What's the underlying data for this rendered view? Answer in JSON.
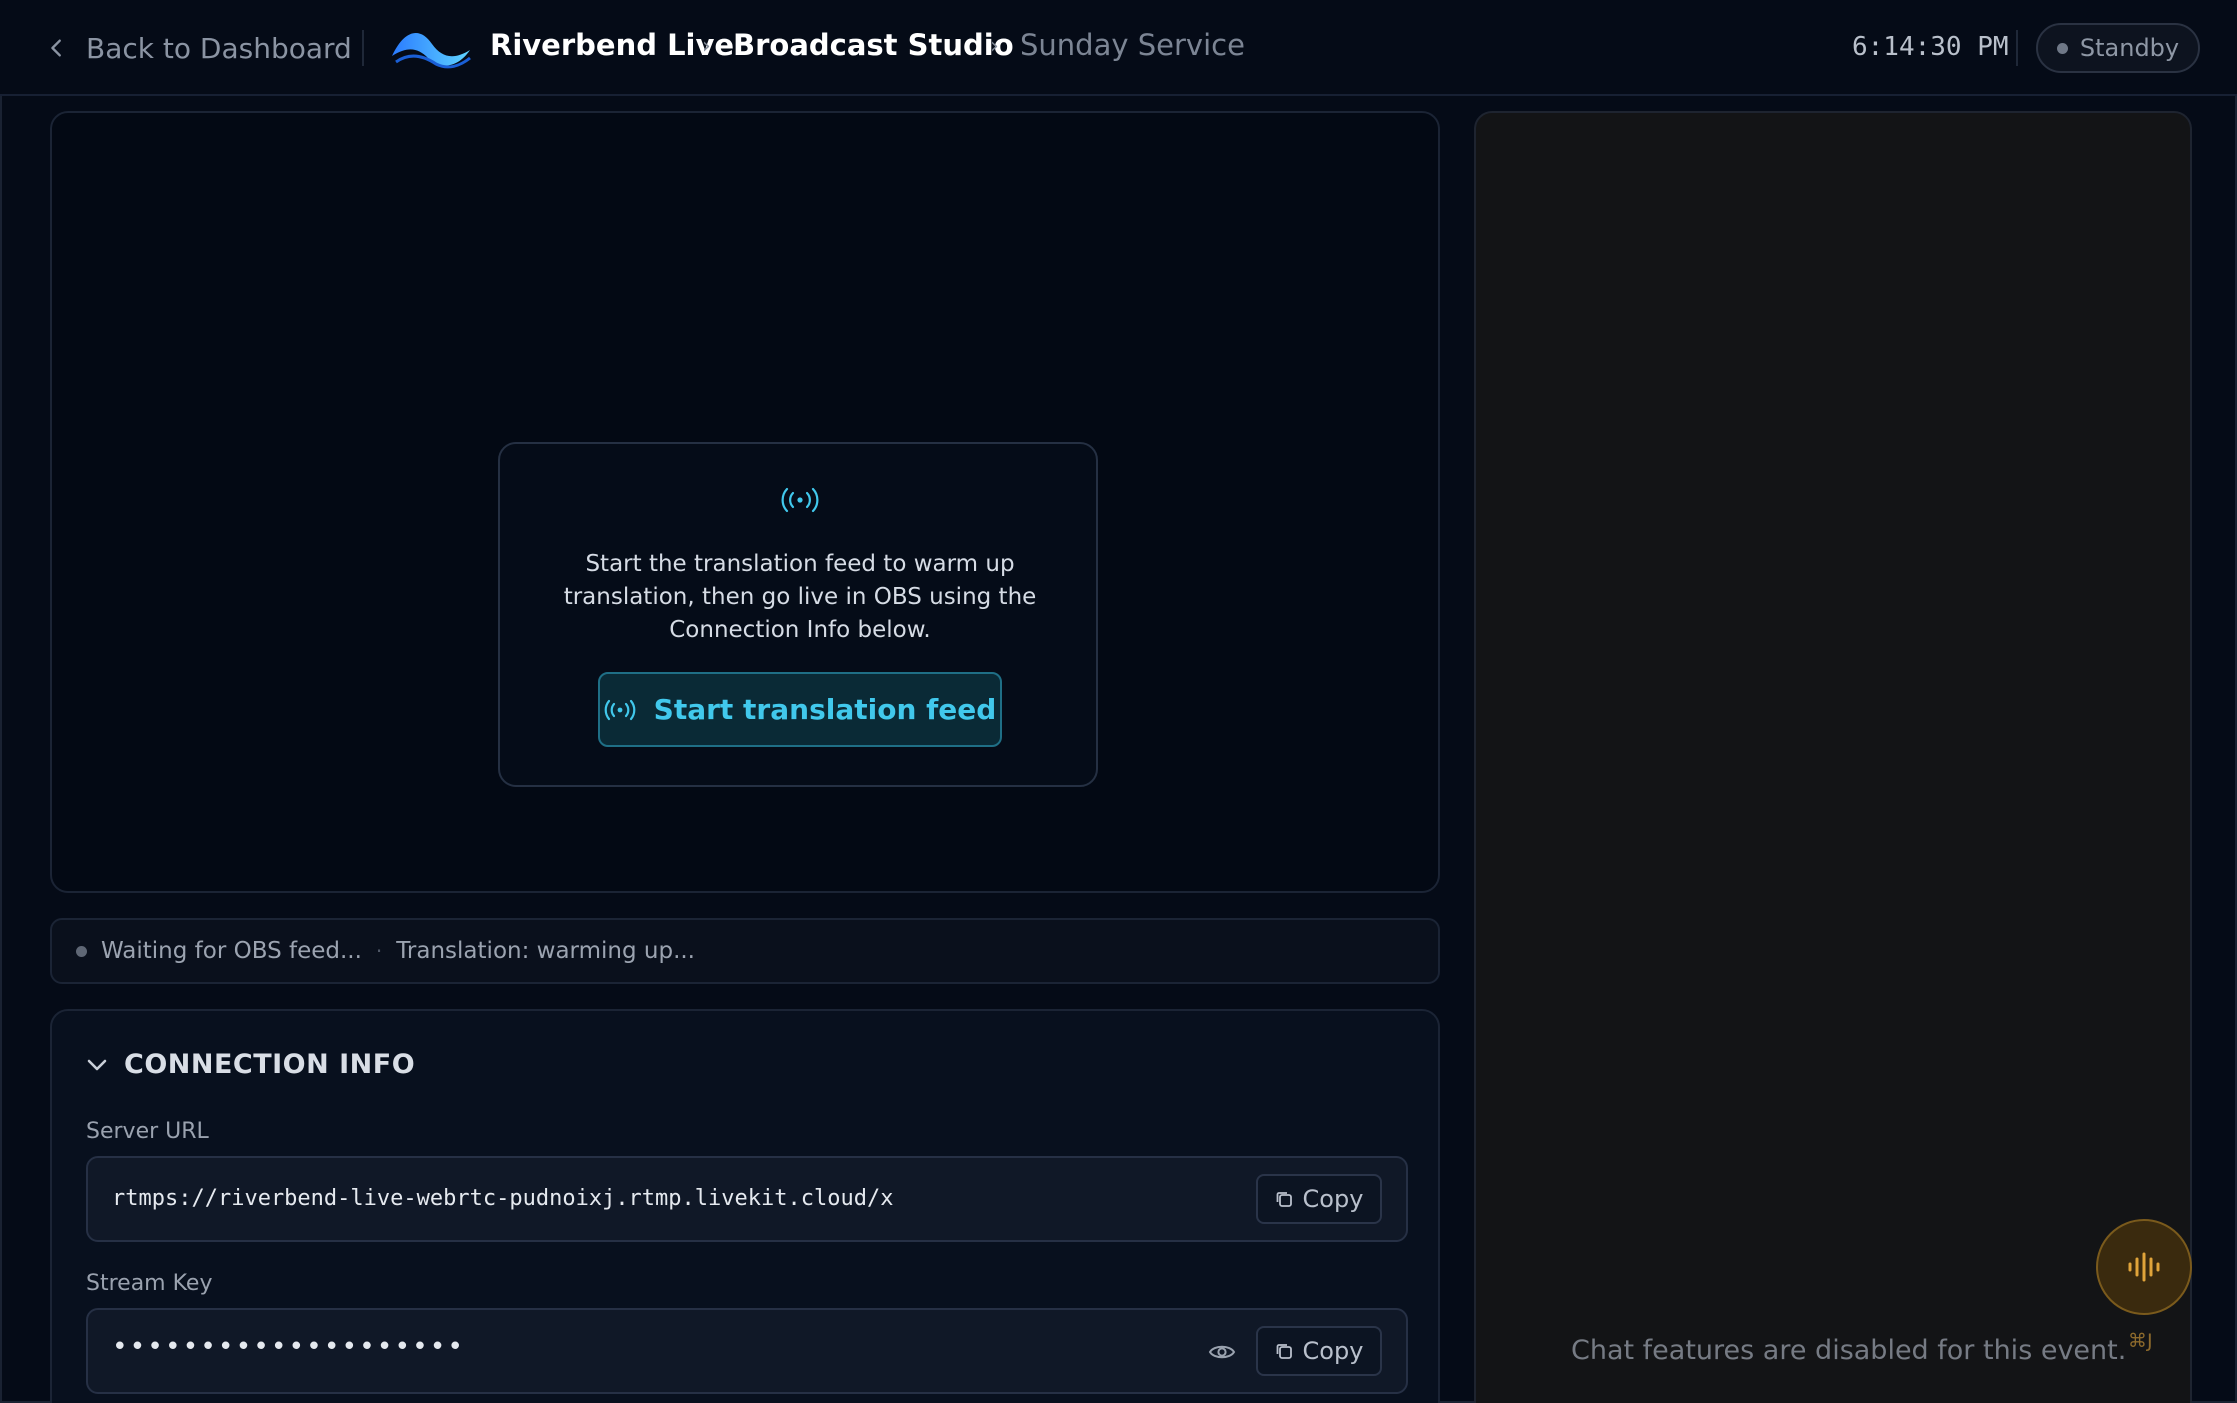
{
  "header": {
    "back_label": "Back to Dashboard",
    "brand": "Riverbend Live",
    "breadcrumb_sep": "›",
    "studio": "Broadcast Studio",
    "event": "Sunday Service",
    "clock": "6:14:30 PM",
    "status": "Standby"
  },
  "preview": {
    "prompt": "Start the translation feed to warm up translation, then go live in OBS using the Connection Info below.",
    "start_button": "Start translation feed"
  },
  "statusbar": {
    "obs": "Waiting for OBS feed...",
    "separator": "·",
    "translation": "Translation: warming up..."
  },
  "connection": {
    "title": "CONNECTION INFO",
    "server_label": "Server URL",
    "server_url": "rtmps://riverbend-live-webrtc-pudnoixj.rtmp.livekit.cloud/x",
    "stream_label": "Stream Key",
    "stream_key_masked": "••••••••••••••••••••",
    "copy_label": "Copy"
  },
  "chat": {
    "disabled_message": "Chat features are disabled for this event.",
    "shortcut": "⌘J"
  },
  "colors": {
    "accent": "#41c8ec",
    "voice_accent": "#e0a43a",
    "background": "#050b17"
  },
  "icons": [
    "chevron-left-icon",
    "brand-wave-logo",
    "broadcast-icon",
    "chevron-down-icon",
    "copy-icon",
    "eye-icon",
    "audio-wave-icon"
  ]
}
